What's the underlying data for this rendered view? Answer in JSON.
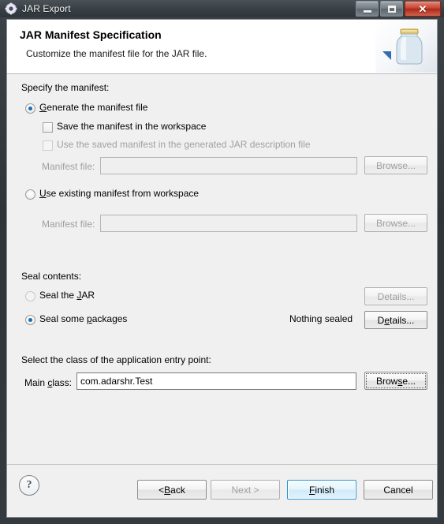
{
  "window": {
    "title": "JAR Export",
    "icon": "jar-export-icon",
    "controls": {
      "minimize": "minimize-icon",
      "maximize": "maximize-icon",
      "close": "✕"
    }
  },
  "header": {
    "title": "JAR Manifest Specification",
    "description": "Customize the manifest file for the JAR file.",
    "banner_icon": "jar-banner-icon"
  },
  "manifest": {
    "section_label": "Specify the manifest:",
    "generate": {
      "label_pre": "",
      "mnemonic": "G",
      "label_post": "enerate the manifest file",
      "label": "Generate the manifest file",
      "checked": true
    },
    "save_workspace": {
      "label": "Save the manifest in the workspace",
      "checked": false,
      "enabled": true
    },
    "use_saved": {
      "label": "Use the saved manifest in the generated JAR description file",
      "checked": false,
      "enabled": false
    },
    "file_label_1": "Manifest file:",
    "file_value_1": "",
    "browse_1": "Browse...",
    "use_existing": {
      "label": "Use existing manifest from workspace",
      "checked": false
    },
    "file_label_2": "Manifest file:",
    "file_value_2": "",
    "browse_2": "Browse..."
  },
  "seal": {
    "section_label": "Seal contents:",
    "seal_jar": {
      "label": "Seal the JAR",
      "checked": false
    },
    "seal_packages": {
      "label": "Seal some packages",
      "checked": true
    },
    "details_1": "Details...",
    "details_2": "Details...",
    "status": "Nothing sealed"
  },
  "entry_point": {
    "section_label": "Select the class of the application entry point:",
    "main_class_label": "Main class:",
    "main_class_value": "com.adarshr.Test",
    "browse": "Browse..."
  },
  "footer": {
    "help_icon": "?",
    "back": "< Back",
    "next": "Next >",
    "finish": "Finish",
    "cancel": "Cancel"
  },
  "colors": {
    "accent": "#2f93d1",
    "radio_dot": "#1c6cb3",
    "dialog_bg": "#f0f0f0",
    "header_bg": "#ffffff",
    "disabled_text": "#a0a0a0"
  }
}
